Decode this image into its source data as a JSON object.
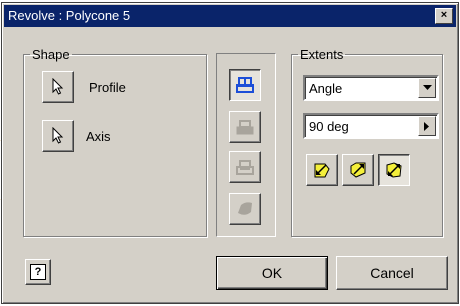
{
  "window": {
    "title": "Revolve : Polycone 5",
    "close_glyph": "×"
  },
  "shape": {
    "legend": "Shape",
    "profile_label": "Profile",
    "axis_label": "Axis",
    "profile_icon": "cursor-select-icon",
    "axis_icon": "cursor-select-icon"
  },
  "operations": {
    "items": [
      {
        "name": "join-icon",
        "enabled": true,
        "active": true
      },
      {
        "name": "cut-icon",
        "enabled": false
      },
      {
        "name": "intersect-icon",
        "enabled": false
      },
      {
        "name": "surface-icon",
        "enabled": false
      }
    ]
  },
  "extents": {
    "legend": "Extents",
    "type_value": "Angle",
    "angle_value": "90 deg",
    "directions": [
      {
        "name": "direction-1-icon",
        "active": false
      },
      {
        "name": "direction-2-icon",
        "active": false
      },
      {
        "name": "symmetric-icon",
        "active": true
      }
    ]
  },
  "footer": {
    "help_glyph": "?",
    "ok_label": "OK",
    "cancel_label": "Cancel"
  },
  "colors": {
    "title_bar": "#0a246a",
    "face": "#d4d0c8",
    "icon_blue": "#1d4fd8",
    "icon_yellow": "#f4ef3a"
  }
}
